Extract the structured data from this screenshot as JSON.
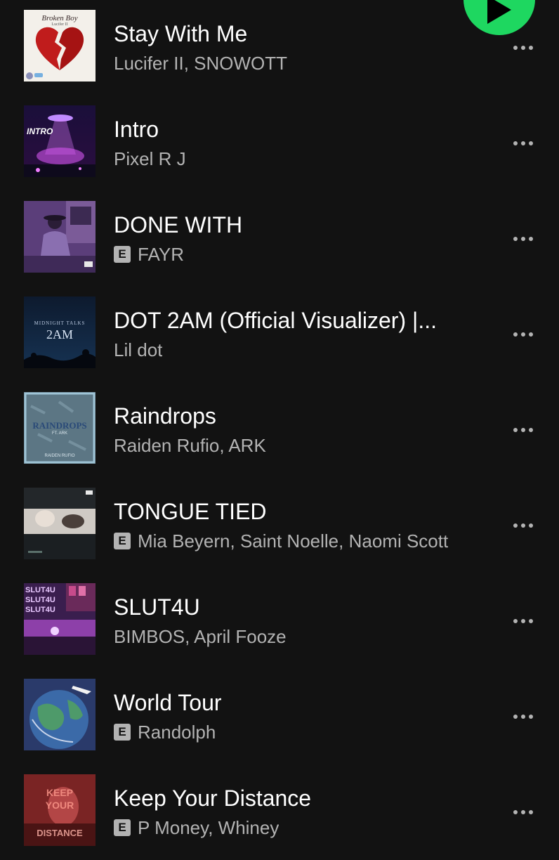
{
  "tracks": [
    {
      "title": "Stay With Me",
      "artists": "Lucifer II, SNOWOTT",
      "explicit": false,
      "cover_text": "Broken Boy",
      "cover_subtext": "Lucifer II",
      "cover_icon": "broken-heart-icon"
    },
    {
      "title": "Intro",
      "artists": "Pixel R J",
      "explicit": false,
      "cover_text": "INTRO",
      "cover_icon": "ufo-icon"
    },
    {
      "title": "DONE WITH",
      "artists": "FAYR",
      "explicit": true,
      "explicit_label": "E",
      "cover_icon": "person-silhouette-icon"
    },
    {
      "title": "DOT 2AM (Official Visualizer) |...",
      "artists": "Lil dot",
      "explicit": false,
      "cover_text": "MIDNIGHT TALKS",
      "cover_subtext": "2AM",
      "cover_icon": "night-hills-icon"
    },
    {
      "title": "Raindrops",
      "artists": "Raiden Rufio, ARK",
      "explicit": false,
      "cover_text": "RAINDROPS",
      "cover_subtext": "FT. ARK",
      "cover_footer": "RAIDEN RUFIO"
    },
    {
      "title": "TONGUE TIED",
      "artists": "Mia Beyern, Saint Noelle, Naomi Scott",
      "explicit": true,
      "explicit_label": "E",
      "cover_icon": "portrait-photo-icon"
    },
    {
      "title": "SLUT4U",
      "artists": "BIMBOS, April Fooze",
      "explicit": false,
      "cover_text": "SLUT4U",
      "cover_icon": "neon-room-icon"
    },
    {
      "title": "World Tour",
      "artists": "Randolph",
      "explicit": true,
      "explicit_label": "E",
      "cover_icon": "globe-icon"
    },
    {
      "title": "Keep Your Distance",
      "artists": "P Money, Whiney",
      "explicit": true,
      "explicit_label": "E",
      "cover_text": "KEEP",
      "cover_subtext": "YOUR",
      "cover_footer": "DISTANCE"
    }
  ],
  "play_button": {
    "icon": "play-icon",
    "color": "#1ed760"
  },
  "more_button_icon": "more-options-icon",
  "colors": {
    "background": "#121212",
    "title": "#ffffff",
    "secondary": "#b3b3b3",
    "accent": "#1ed760"
  }
}
